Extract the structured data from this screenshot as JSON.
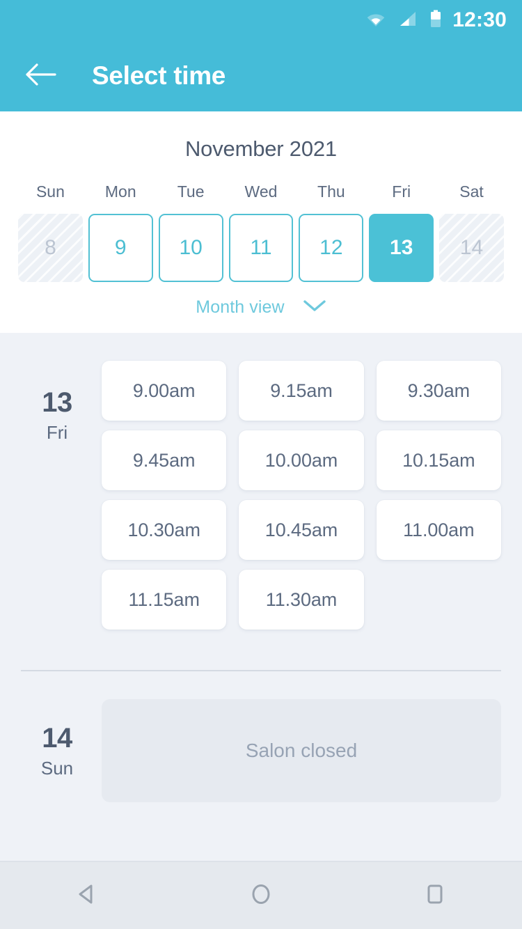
{
  "status_bar": {
    "time": "12:30",
    "icons": [
      "wifi-icon",
      "cellular-signal-icon",
      "battery-icon"
    ]
  },
  "app_bar": {
    "back_icon": "arrow-left-icon",
    "title": "Select time"
  },
  "calendar": {
    "month_title": "November 2021",
    "weekdays": [
      "Sun",
      "Mon",
      "Tue",
      "Wed",
      "Thu",
      "Fri",
      "Sat"
    ],
    "days": [
      {
        "number": "8",
        "state": "disabled"
      },
      {
        "number": "9",
        "state": "enabled"
      },
      {
        "number": "10",
        "state": "enabled"
      },
      {
        "number": "11",
        "state": "enabled"
      },
      {
        "number": "12",
        "state": "enabled"
      },
      {
        "number": "13",
        "state": "selected"
      },
      {
        "number": "14",
        "state": "disabled"
      }
    ],
    "month_view_label": "Month view",
    "month_view_icon": "chevron-down-icon"
  },
  "schedule": [
    {
      "day_number": "13",
      "day_name": "Fri",
      "slots": [
        "9.00am",
        "9.15am",
        "9.30am",
        "9.45am",
        "10.00am",
        "10.15am",
        "10.30am",
        "10.45am",
        "11.00am",
        "11.15am",
        "11.30am"
      ]
    },
    {
      "day_number": "14",
      "day_name": "Sun",
      "closed_message": "Salon closed"
    }
  ],
  "nav_bar": {
    "back_icon": "nav-back-triangle-icon",
    "home_icon": "nav-home-circle-icon",
    "recents_icon": "nav-recents-square-icon"
  },
  "colors": {
    "brand_teal": "#45bcd8",
    "selected_day": "#4bc1d6",
    "day_border": "#52c1d4",
    "page_background": "#eff2f7",
    "text_slate": "#4d5a6e",
    "muted_text": "#97a3b4"
  }
}
